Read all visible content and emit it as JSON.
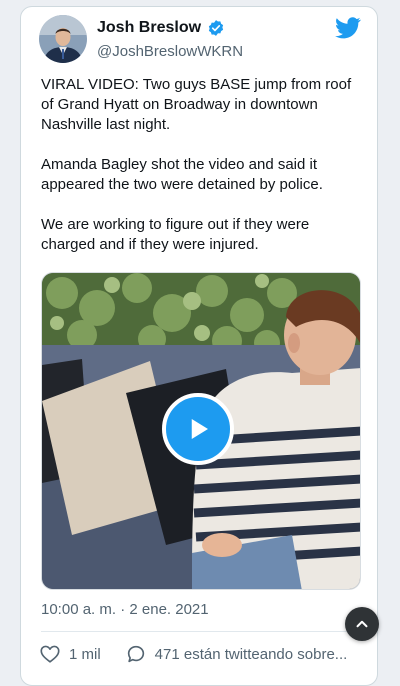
{
  "tweet": {
    "author_name": "Josh Breslow",
    "author_handle": "@JoshBreslowWKRN",
    "paragraphs": [
      "VIRAL VIDEO: Two guys BASE jump from roof of Grand Hyatt on Broadway in downtown Nashville last night.",
      "Amanda Bagley shot the video and said it appeared the two were detained by police.",
      "We are working to figure out if they were charged and if they were injured."
    ],
    "timestamp": "10:00 a. m. · 2 ene. 2021",
    "likes": "1 mil",
    "conversation": "471 están twitteando sobre..."
  },
  "icons": {
    "verified": "verified-badge-icon",
    "brand": "twitter-bird-icon",
    "play": "play-icon",
    "like": "heart-icon",
    "reply": "speech-bubble-icon",
    "scroll": "chevron-up-icon"
  },
  "colors": {
    "accent": "#1d9bf0",
    "text": "#0f1419",
    "muted": "#536471"
  }
}
